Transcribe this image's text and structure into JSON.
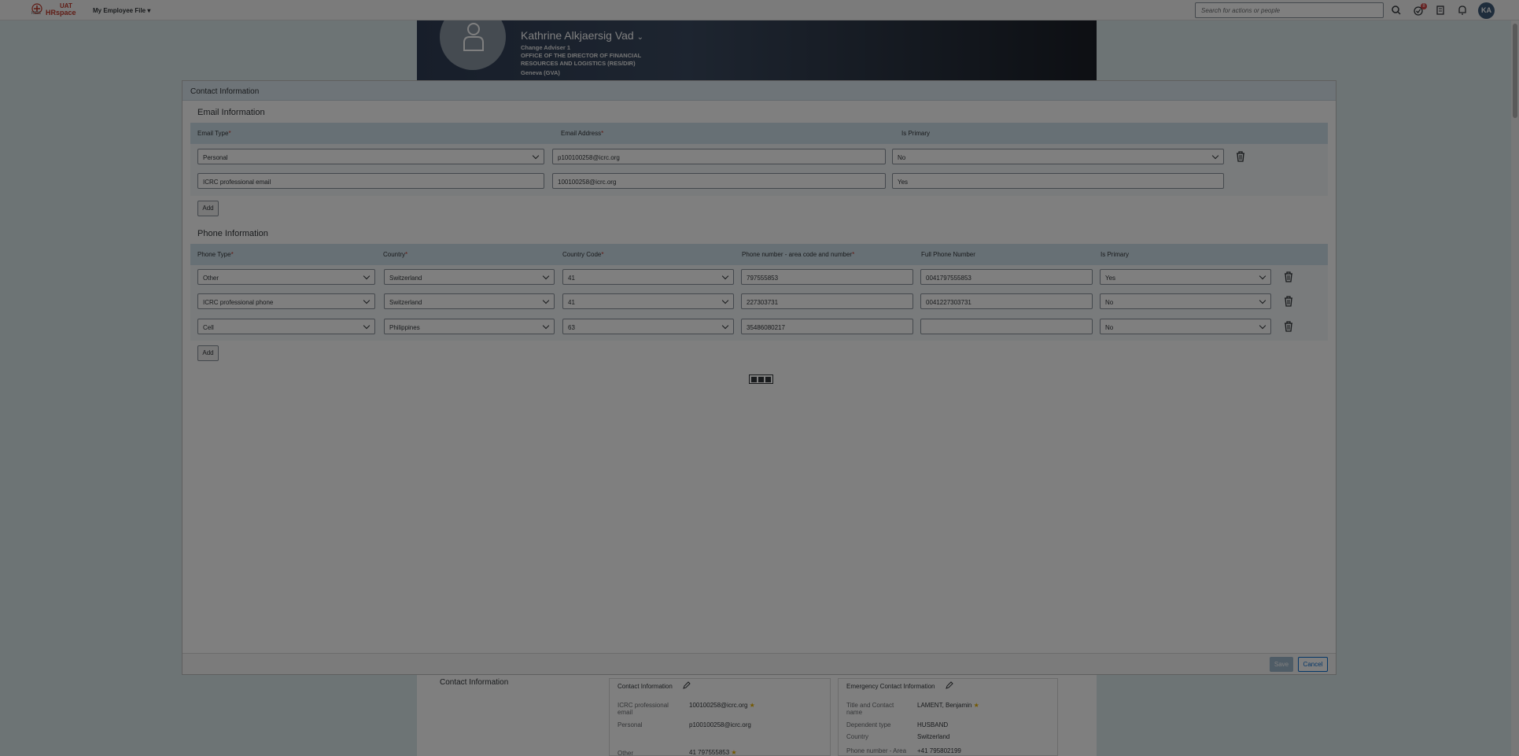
{
  "shell": {
    "logo_icrc": "ICRC",
    "logo_uat": "UAT",
    "logo_hr": "HRspace",
    "app_title": "My Employee File",
    "search_placeholder": "Search for actions or people",
    "notification_count": "8",
    "user_initials": "KA"
  },
  "profile": {
    "name": "Kathrine Alkjaersig Vad",
    "line1": "Change Adviser 1",
    "line2": "OFFICE OF THE DIRECTOR OF FINANCIAL",
    "line3": "RESOURCES AND LOGISTICS (RES/DIR)",
    "line4": "Geneva (GVA)"
  },
  "background_card": {
    "section_title": "Contact Information",
    "contact_box": {
      "title": "Contact Information",
      "rows": [
        {
          "label": "ICRC professional email",
          "value": "100100258@icrc.org"
        },
        {
          "label": "Personal",
          "value": "p100100258@icrc.org"
        },
        {
          "label": "Other",
          "value": "41 797555853"
        }
      ]
    },
    "emergency_box": {
      "title": "Emergency Contact Information",
      "rows": [
        {
          "label": "Title and Contact name",
          "value": "LAMENT, Benjamin"
        },
        {
          "label": "Dependent type",
          "value": "HUSBAND"
        },
        {
          "label": "Country",
          "value": "Switzerland"
        },
        {
          "label": "Phone number - Area",
          "value": "+41 795802199"
        }
      ]
    }
  },
  "dialog": {
    "title": "Contact Information",
    "email_section": {
      "title": "Email Information",
      "headers": {
        "type": "Email Type",
        "address": "Email Address",
        "primary": "Is Primary"
      },
      "rows": [
        {
          "type": "Personal",
          "address": "p100100258@icrc.org",
          "primary": "No"
        },
        {
          "type": "ICRC professional email",
          "address": "100100258@icrc.org",
          "primary": "Yes"
        }
      ],
      "add_label": "Add"
    },
    "phone_section": {
      "title": "Phone Information",
      "headers": {
        "type": "Phone Type",
        "country": "Country",
        "code": "Country Code",
        "number": "Phone number - area code and number",
        "full": "Full Phone Number",
        "primary": "Is Primary"
      },
      "rows": [
        {
          "type": "Other",
          "country": "Switzerland",
          "code": "41",
          "number": "797555853",
          "full": "0041797555853",
          "primary": "Yes"
        },
        {
          "type": "ICRC professional phone",
          "country": "Switzerland",
          "code": "41",
          "number": "227303731",
          "full": "0041227303731",
          "primary": "No"
        },
        {
          "type": "Cell",
          "country": "Philippines",
          "code": "63",
          "number": "35486080217",
          "full": "",
          "primary": "No"
        }
      ],
      "add_label": "Add"
    },
    "save_label": "Save",
    "cancel_label": "Cancel"
  }
}
